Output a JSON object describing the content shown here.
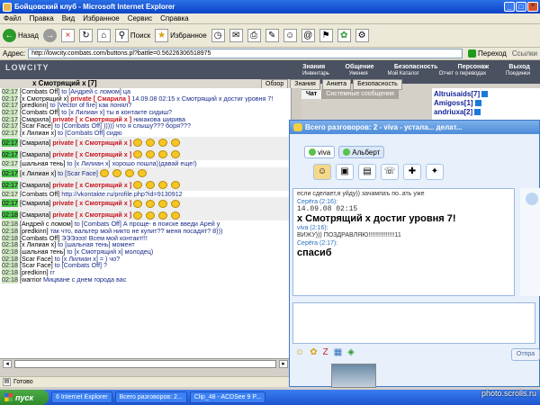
{
  "ie": {
    "title": "Бойцовский клуб - Microsoft Internet Explorer",
    "menu": [
      "Файл",
      "Правка",
      "Вид",
      "Избранное",
      "Сервис",
      "Справка"
    ],
    "back_label": "Назад",
    "search_label": "Поиск",
    "favorites_label": "Избранное",
    "address_label": "Адрес:",
    "url": "http://lowcity.combats.com/buttons.pl?battle=0.56226306518975",
    "go_label": "Переход",
    "links_label": "Ссылки",
    "status": "Готово"
  },
  "game": {
    "logo": "LOWCITY",
    "nav_top": [
      "Знания",
      "Общение",
      "Безопасность",
      "Персонаж",
      "Выход"
    ],
    "nav_bottom": [
      "Инвентарь",
      "Умения",
      "Мой Каталог",
      "Отчет о переводах",
      "Поединки"
    ],
    "room": "х Смотрящий х [7]",
    "tabs": [
      "Обзор",
      "Знания",
      "Анкета",
      "Безопасность"
    ],
    "subtabs": [
      "Чат",
      "Системные сообщения"
    ],
    "users": [
      {
        "name": "Altruisaids[7]"
      },
      {
        "name": "Amigoss[1]"
      },
      {
        "name": "andriuxa[2]"
      }
    ]
  },
  "chat": [
    {
      "time": "02:17",
      "nick": "[Combats Off]",
      "to": "to [Андрей с ломом]",
      "msg": "ца"
    },
    {
      "time": "02:17",
      "nick": "[х Смотрящий х]",
      "priv": "private [ Смарила ]",
      "msg": "14.09.08 02:15 х Смотрящий х достиг уровня 7!"
    },
    {
      "time": "02:17",
      "nick": "[predkinn]",
      "to": "to [Vector of fire]",
      "msg": "как понял?"
    },
    {
      "time": "02:17",
      "nick": "[Combats Off]",
      "to": "to [х Лилиан х]",
      "msg": "ты в контакте сидиш?"
    },
    {
      "time": "02:17",
      "nick": "[Смарила]",
      "priv": "private [ х Смотрящий х ]",
      "msg": "никакова ширива"
    },
    {
      "time": "02:17",
      "nick": "[Scar Face]",
      "to": "to [Combats Off]",
      "msg": "))))) что я слышу??? боря???"
    },
    {
      "time": "02:17",
      "nick": "[х Лилиан х]",
      "to": "to [Combats Off]",
      "msg": "сидю"
    },
    {
      "time": "02:17",
      "nick": "[Смарила]",
      "priv": "private [ х Смотрящий х ]",
      "msg": ""
    },
    {
      "time": "02:17",
      "nick": "[Смарила]",
      "priv": "private [ х Смотрящий х ]",
      "msg": ""
    },
    {
      "time": "02:17",
      "nick": "[шальная тень]",
      "to": "to [х Лилиан х]",
      "msg": "хорошо пошла))давай еще!)"
    },
    {
      "time": "02:17",
      "nick": "[х Лилиан х]",
      "to": "to [Scar Face]",
      "msg": ""
    },
    {
      "time": "02:17",
      "nick": "[Смарила]",
      "priv": "private [ х Смотрящий х ]",
      "msg": ""
    },
    {
      "time": "02:17",
      "nick": "[Combats Off]",
      "to": "",
      "msg": "http://vkontakte.ru/profile.php?id=9130912"
    },
    {
      "time": "02:17",
      "nick": "[Смарила]",
      "priv": "private [ х Смотрящий х ]",
      "msg": ""
    },
    {
      "time": "02:18",
      "nick": "[Смарила]",
      "priv": "private [ х Смотрящий х ]",
      "msg": ""
    },
    {
      "time": "02:18",
      "nick": "[Андрей с ломом]",
      "to": "to [Combats Off]",
      "msg": "А проще- в поиске введи Арей у"
    },
    {
      "time": "02:18",
      "nick": "[predkinn]",
      "to": "",
      "msg": "так что, вальтер мой никто не купит?? меня посадят? 8)))"
    },
    {
      "time": "02:18",
      "nick": "[Combats Off]",
      "to": "",
      "msg": "ЭЭЭэээ! Всем мой контакт!!!"
    },
    {
      "time": "02:18",
      "nick": "[х Лилиан х]",
      "to": "to [шальная тень]",
      "msg": "момент"
    },
    {
      "time": "02:18",
      "nick": "[шальная тень]",
      "to": "to [х Смотрящий х]",
      "msg": "молодец)"
    },
    {
      "time": "02:18",
      "nick": "[Scar Face]",
      "to": "to [х Лилиан х]",
      "msg": "= ) чо?"
    },
    {
      "time": "02:18",
      "nick": "[Scar Face]",
      "to": "to [Combats Off]",
      "msg": "?"
    },
    {
      "time": "02:18",
      "nick": "[predkinn]",
      "to": "",
      "msg": "гг"
    },
    {
      "time": "02:18",
      "nick": "[warrior",
      "to": "",
      "msg": "Мицване с днем города вас"
    }
  ],
  "messenger": {
    "title": "Всего разговоров: 2 - viva - устала... делат...",
    "contacts": [
      "viva",
      "Альберт"
    ],
    "conv": [
      {
        "type": "text",
        "text": "если сделает,я уйду)) зачампаъ по..ать уже"
      },
      {
        "type": "sender",
        "text": "Серёга (2:16):"
      },
      {
        "type": "mono",
        "text": "14.09.08 02:15"
      },
      {
        "type": "big",
        "text": "х Смотрящий х достиг уровня 7!"
      },
      {
        "type": "sender",
        "text": "viva (2:16):"
      },
      {
        "type": "text",
        "text": "ВИЖУ))) ПОЗДРАВЛЯЮ!!!!!!!!!!!!!!!11"
      },
      {
        "type": "sender",
        "text": "Серёга (2:17):"
      },
      {
        "type": "big",
        "text": "спасиб"
      }
    ],
    "send_label": "Отпра"
  },
  "taskbar": {
    "start": "пуск",
    "items": [
      "6 Internet Explorer",
      "Всего разговоров: 2...",
      "Clip_48 - ACDSee 9 P..."
    ]
  },
  "watermark": "photo.scrolls.ru",
  "colors": {
    "private": "#c8141e",
    "to": "#1a2c88",
    "time_green": "#4cc34c"
  }
}
